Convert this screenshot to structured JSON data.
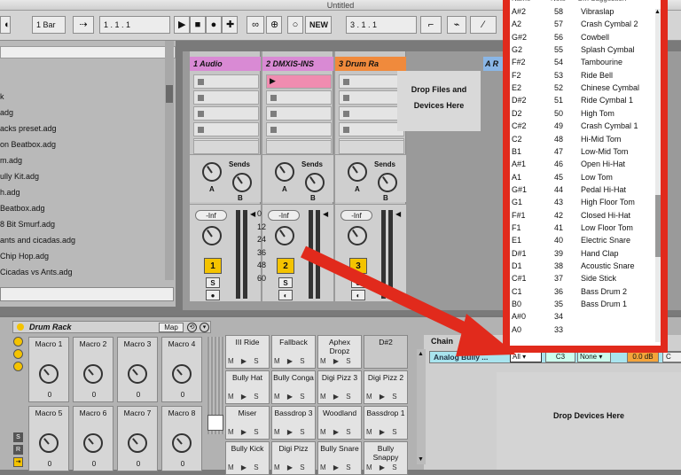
{
  "window": {
    "title": "Untitled"
  },
  "transport": {
    "quantize": "1 Bar",
    "position": "1 .   1 .   1",
    "new_button": "NEW",
    "loop_position": "3 .   1 .   1"
  },
  "browser": {
    "items": [
      "k",
      "adg",
      "acks preset.adg",
      "on Beatbox.adg",
      "m.adg",
      "ully Kit.adg",
      "h.adg",
      "Beatbox.adg",
      "8 Bit Smurf.adg",
      "ants and cicadas.adg",
      "Chip Hop.adg",
      "Cicadas vs Ants.adg"
    ],
    "selected_index": 5
  },
  "session": {
    "tracks": [
      {
        "name": "1 Audio",
        "color": "#d98ad4",
        "number": "1"
      },
      {
        "name": "2 DMXIS-INS",
        "color": "#d98ad4",
        "number": "2"
      },
      {
        "name": "3 Drum Ra",
        "color": "#f08a3c",
        "number": "3"
      }
    ],
    "sends_label": "Sends",
    "send_a": "A",
    "send_b": "B",
    "volume": "-Inf",
    "solo": "S",
    "drop_files": "Drop Files and",
    "drop_devices": "Devices Here",
    "return_track": "A R",
    "meter_scale": [
      "0",
      "12",
      "24",
      "36",
      "48",
      "60"
    ]
  },
  "drum_rack": {
    "title": "Drum Rack",
    "map_button": "Map",
    "macros": [
      {
        "label": "Macro 1",
        "value": "0"
      },
      {
        "label": "Macro 2",
        "value": "0"
      },
      {
        "label": "Macro 3",
        "value": "0"
      },
      {
        "label": "Macro 4",
        "value": "0"
      },
      {
        "label": "Macro 5",
        "value": "0"
      },
      {
        "label": "Macro 6",
        "value": "0"
      },
      {
        "label": "Macro 7",
        "value": "0"
      },
      {
        "label": "Macro 8",
        "value": "0"
      }
    ],
    "pads": [
      "III Ride",
      "Fallback",
      "Aphex Dropz",
      "D#2",
      "Bully Hat",
      "Bully Conga",
      "Digi Pizz 3",
      "Digi Pizz 2",
      "Miser",
      "Bassdrop 3",
      "Woodland",
      "Bassdrop 1",
      "Bully Kick",
      "Digi Pizz",
      "Bully Snare",
      "Bully Snappy"
    ],
    "pad_controls": "M ▶ S",
    "chain_label": "Chain",
    "chain_name": "Analog Bully ...",
    "chain_in": "All",
    "chain_note": "C3",
    "chain_choke": "None",
    "chain_volume": "0.0 dB",
    "chain_pan": "C",
    "drop_devices": "Drop Devices Here"
  },
  "choke_popup": {
    "headers": [
      "Name",
      "Note",
      "Gm Suggestion"
    ],
    "rows": [
      [
        "A#2",
        "58",
        "Vibraslap"
      ],
      [
        "A2",
        "57",
        "Crash Cymbal 2"
      ],
      [
        "G#2",
        "56",
        "Cowbell"
      ],
      [
        "G2",
        "55",
        "Splash Cymbal"
      ],
      [
        "F#2",
        "54",
        "Tambourine"
      ],
      [
        "F2",
        "53",
        "Ride Bell"
      ],
      [
        "E2",
        "52",
        "Chinese Cymbal"
      ],
      [
        "D#2",
        "51",
        "Ride Cymbal 1"
      ],
      [
        "D2",
        "50",
        "High Tom"
      ],
      [
        "C#2",
        "49",
        "Crash Cymbal 1"
      ],
      [
        "C2",
        "48",
        "Hi-Mid Tom"
      ],
      [
        "B1",
        "47",
        "Low-Mid Tom"
      ],
      [
        "A#1",
        "46",
        "Open Hi-Hat"
      ],
      [
        "A1",
        "45",
        "Low Tom"
      ],
      [
        "G#1",
        "44",
        "Pedal Hi-Hat"
      ],
      [
        "G1",
        "43",
        "High Floor Tom"
      ],
      [
        "F#1",
        "42",
        "Closed Hi-Hat"
      ],
      [
        "F1",
        "41",
        "Low Floor Tom"
      ],
      [
        "E1",
        "40",
        "Electric Snare"
      ],
      [
        "D#1",
        "39",
        "Hand Clap"
      ],
      [
        "D1",
        "38",
        "Acoustic Snare"
      ],
      [
        "C#1",
        "37",
        "Side Stick"
      ],
      [
        "C1",
        "36",
        "Bass Drum 2"
      ],
      [
        "B0",
        "35",
        "Bass Drum 1"
      ],
      [
        "A#0",
        "34",
        ""
      ],
      [
        "A0",
        "33",
        ""
      ]
    ],
    "accent": "#e12a1c"
  }
}
